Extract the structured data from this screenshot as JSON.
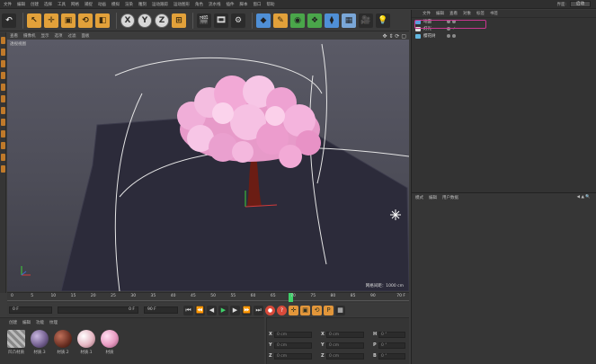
{
  "menubar": {
    "items": [
      "文件",
      "编辑",
      "创建",
      "选择",
      "工具",
      "网格",
      "捕捉",
      "动画",
      "模拟",
      "渲染",
      "雕刻",
      "运动跟踪",
      "运动图形",
      "角色",
      "流水线",
      "插件",
      "脚本",
      "窗口",
      "帮助"
    ],
    "layout_label": "界面:",
    "layout_value": "启动"
  },
  "toolbar": {
    "undo": "↶",
    "x_label": "X",
    "y_label": "Y",
    "z_label": "Z"
  },
  "viewport": {
    "menu": [
      "查看",
      "摄像机",
      "显示",
      "选项",
      "过滤",
      "面板"
    ],
    "nav_icons": "✥ ⇕ ⟳ ▢",
    "camera": "透视视图",
    "grid_spacing": "网格间距：1000 cm"
  },
  "timeline": {
    "ticks": [
      "0",
      "5",
      "10",
      "15",
      "20",
      "25",
      "30",
      "35",
      "40",
      "45",
      "50",
      "55",
      "60",
      "65",
      "70",
      "75",
      "80",
      "85",
      "90"
    ],
    "current_frame": 70,
    "end_label": "70 F"
  },
  "playback": {
    "start_frame": "0 F",
    "min_field": "0 F",
    "max_field": "90 F",
    "end_field": "90 F"
  },
  "material_manager": {
    "menu": [
      "创建",
      "编辑",
      "功能",
      "纹理"
    ],
    "materials": [
      {
        "name": "凹凸材质",
        "color": "#9a9a9a"
      },
      {
        "name": "材质.3",
        "color": "#6e5a8a"
      },
      {
        "name": "材质.2",
        "color": "#6a2f22"
      },
      {
        "name": "材质.1",
        "color": "#e6b8c4"
      },
      {
        "name": "材质",
        "color": "#e79ac1"
      }
    ]
  },
  "coordinates": {
    "rows": [
      {
        "a": "X",
        "v1": "0 cm",
        "b": "X",
        "v2": "0 cm",
        "c": "H",
        "v3": "0 °"
      },
      {
        "a": "Y",
        "v1": "0 cm",
        "b": "Y",
        "v2": "0 cm",
        "c": "P",
        "v3": "0 °"
      },
      {
        "a": "Z",
        "v1": "0 cm",
        "b": "Z",
        "v2": "0 cm",
        "c": "B",
        "v3": "0 °"
      }
    ]
  },
  "object_manager": {
    "menu": [
      "文件",
      "编辑",
      "查看",
      "对象",
      "标签",
      "书签"
    ],
    "objects": [
      {
        "name": "地面",
        "icon_color": "#5aa0e0"
      },
      {
        "name": "灯光",
        "icon_color": "#e0e0e0"
      },
      {
        "name": "樱花树",
        "icon_color": "#62b7e0"
      }
    ]
  },
  "attribute_manager": {
    "menu": [
      "模式",
      "编辑",
      "用户数据"
    ],
    "nav_icons": "◀ ▲ 🔍"
  },
  "colors": {
    "accent_highlight": "#c8358f",
    "timeline_marker": "#3fd16a",
    "blossom_pink": "#f2a9d6",
    "trunk": "#6b1d14"
  }
}
